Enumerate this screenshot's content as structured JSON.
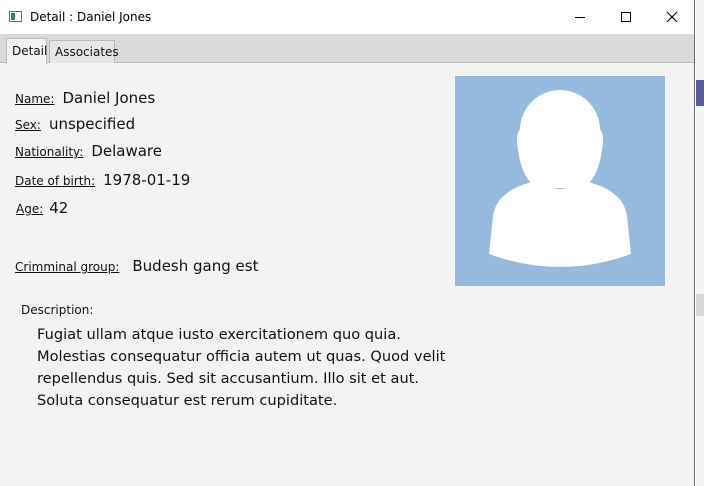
{
  "window": {
    "title": "Detail : Daniel Jones",
    "controls": [
      "minimize-icon",
      "maximize-icon",
      "close-icon"
    ]
  },
  "tabs": [
    {
      "label": "Detail",
      "selected": true
    },
    {
      "label": "Associates",
      "selected": false
    }
  ],
  "fields": {
    "name": {
      "label": "Name:",
      "value": "Daniel Jones"
    },
    "sex": {
      "label": "Sex:",
      "value": "unspecified"
    },
    "nationality": {
      "label": "Nationality:",
      "value": "Delaware"
    },
    "dob": {
      "label": "Date of birth:",
      "value": "1978-01-19"
    },
    "age": {
      "label": "Age:",
      "value": "42"
    },
    "group": {
      "label": "Crimminal group:",
      "value": "Budesh gang est"
    }
  },
  "description": {
    "label": "Description:",
    "text": "Fugiat ullam atque iusto exercitationem quo quia. Molestias consequatur officia autem ut quas. Quod velit repellendus quis. Sed sit accusantium. Illo sit et aut. Soluta consequatur est rerum cupiditate."
  },
  "avatar": {
    "icon": "person-placeholder-icon",
    "background": "#96b9de"
  }
}
